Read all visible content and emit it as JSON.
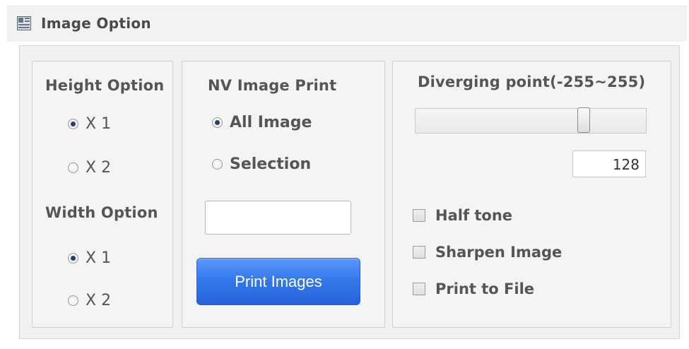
{
  "window": {
    "title": "Image Option"
  },
  "height_option": {
    "heading": "Height Option",
    "options": [
      {
        "label": "X 1",
        "selected": true
      },
      {
        "label": "X 2",
        "selected": false
      }
    ]
  },
  "width_option": {
    "heading": "Width Option",
    "options": [
      {
        "label": "X 1",
        "selected": true
      },
      {
        "label": "X 2",
        "selected": false
      }
    ]
  },
  "nv_image_print": {
    "heading": "NV Image Print",
    "options": [
      {
        "label": "All Image",
        "selected": true
      },
      {
        "label": "Selection",
        "selected": false
      }
    ],
    "selection_value": "",
    "print_button_label": "Print Images"
  },
  "diverging": {
    "heading": "Diverging point(-255~255)",
    "min": -255,
    "max": 255,
    "value": "128"
  },
  "checkboxes": [
    {
      "label": "Half tone",
      "checked": false
    },
    {
      "label": "Sharpen Image",
      "checked": false
    },
    {
      "label": "Print to File",
      "checked": false
    }
  ],
  "colors": {
    "button_blue": "#3579ea",
    "radio_dot": "#2c3e68",
    "panel_bg": "#f4f4f4"
  }
}
